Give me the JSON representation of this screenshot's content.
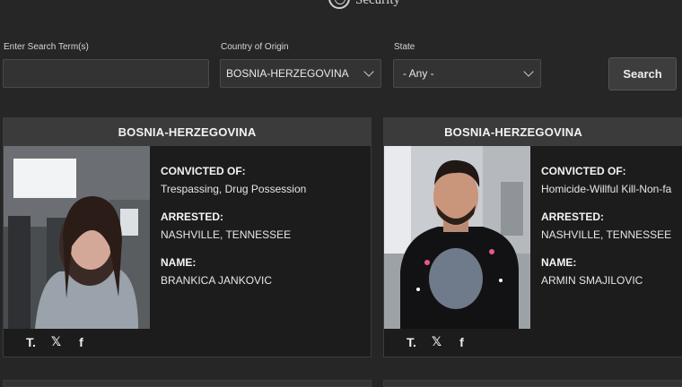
{
  "header": {
    "agency_text": "Security"
  },
  "search": {
    "term_label": "Enter Search Term(s)",
    "term_value": "",
    "country_label": "Country of Origin",
    "country_value": "BOSNIA-HERZEGOVINA",
    "state_label": "State",
    "state_value": "- Any -",
    "button_label": "Search"
  },
  "cards": [
    {
      "country": "BOSNIA-HERZEGOVINA",
      "convicted_label": "CONVICTED OF:",
      "convicted_value": "Trespassing, Drug Possession",
      "arrested_label": "ARRESTED:",
      "arrested_value": "NASHVILLE, TENNESSEE",
      "name_label": "NAME:",
      "name_value": "BRANKICA JANKOVIC"
    },
    {
      "country": "BOSNIA-HERZEGOVINA",
      "convicted_label": "CONVICTED OF:",
      "convicted_value": "Homicide-Willful Kill-Non-fa",
      "arrested_label": "ARRESTED:",
      "arrested_value": "NASHVILLE, TENNESSEE",
      "name_label": "NAME:",
      "name_value": "ARMIN SMAJILOVIC"
    }
  ],
  "social": {
    "truth": "T.",
    "x": "𝕏",
    "facebook": "f"
  },
  "icons": [
    "seal-icon",
    "chevron-down-icon",
    "truth-social-icon",
    "x-icon",
    "facebook-icon"
  ]
}
